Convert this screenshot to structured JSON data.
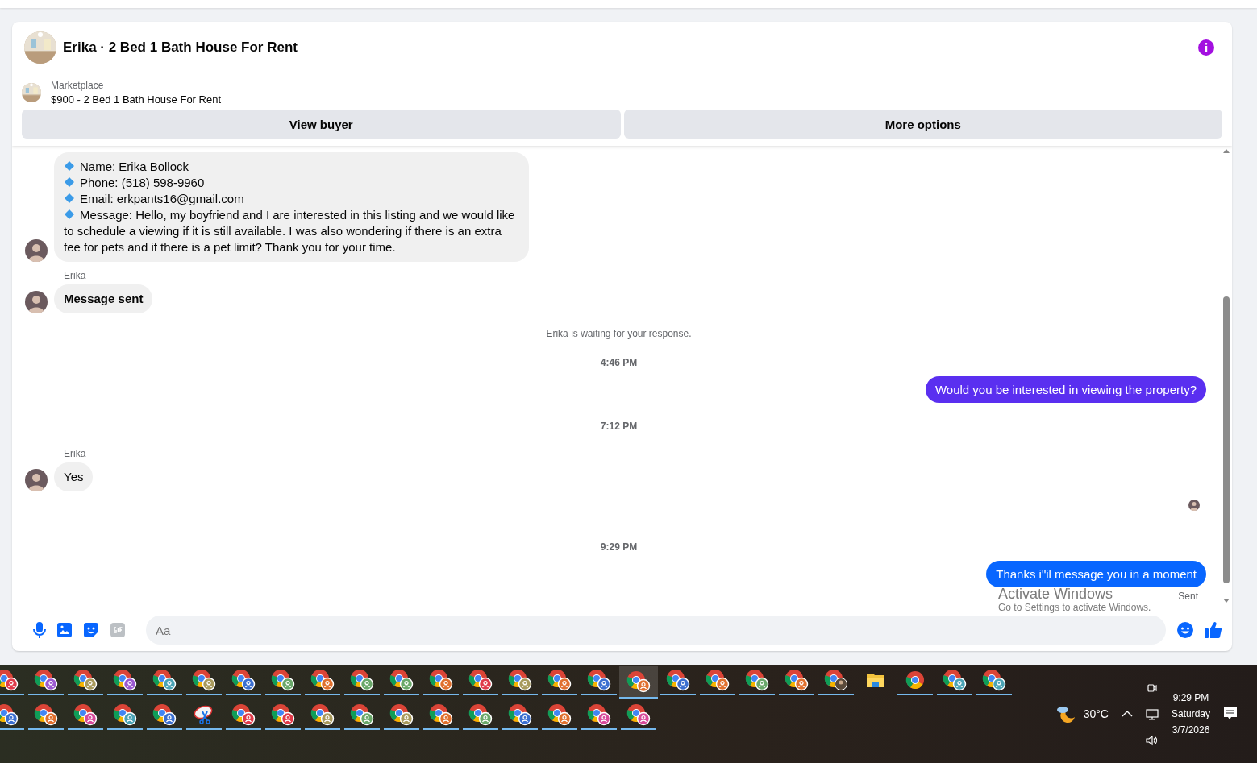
{
  "chat": {
    "title": "Erika · 2 Bed 1 Bath House For Rent",
    "listing": {
      "label": "Marketplace",
      "name": "$900 - 2 Bed 1 Bath House For Rent"
    },
    "actions": [
      "View buyer",
      "More options"
    ],
    "messages": [
      {
        "kind": "details",
        "lines": [
          "Name: Erika Bollock",
          "Phone: (518) 598-9960",
          "Email: erkpants16@gmail.com",
          "Message: Hello, my boyfriend and I are interested in this listing and we would like to schedule a viewing if it is still available. I was also wondering if there is an extra fee for pets and if there is a pet limit? Thank you for your time."
        ]
      },
      {
        "kind": "incoming",
        "sender": "Erika",
        "text": "Message sent",
        "bold": true
      },
      {
        "kind": "notice",
        "text": "Erika is waiting for your response."
      },
      {
        "kind": "time",
        "text": "4:46 PM"
      },
      {
        "kind": "outgoing",
        "text": "Would you be interested in viewing the property?",
        "color": "#5a2ff0"
      },
      {
        "kind": "time",
        "text": "7:12 PM"
      },
      {
        "kind": "incoming",
        "sender": "Erika",
        "text": "Yes",
        "bold": false
      },
      {
        "kind": "seen"
      },
      {
        "kind": "time",
        "text": "9:29 PM"
      },
      {
        "kind": "outgoing",
        "text": "Thanks i\"il message you in a moment",
        "color": "#0866ff"
      },
      {
        "kind": "status",
        "text": "Sent"
      }
    ],
    "composer": {
      "placeholder": "Aa"
    }
  },
  "activation_notice": {
    "title": "Activate Windows",
    "subtitle": "Go to Settings to activate Windows."
  },
  "taskbar": {
    "rows": [
      [
        {
          "kind": "browser",
          "color": "#e03b4a",
          "running": true,
          "selected": false
        },
        {
          "kind": "browser",
          "color": "#9b59d0",
          "running": true,
          "selected": false
        },
        {
          "kind": "browser",
          "color": "#a89a5c",
          "running": true,
          "selected": false
        },
        {
          "kind": "browser",
          "color": "#9b59d0",
          "running": true,
          "selected": false
        },
        {
          "kind": "browser",
          "color": "#4aa3b5",
          "running": true,
          "selected": false
        },
        {
          "kind": "browser",
          "color": "#a89a5c",
          "running": true,
          "selected": false
        },
        {
          "kind": "browser",
          "color": "#3b6fd0",
          "running": true,
          "selected": false
        },
        {
          "kind": "browser",
          "color": "#6aa86a",
          "running": true,
          "selected": false
        },
        {
          "kind": "browser",
          "color": "#e0702e",
          "running": true,
          "selected": false
        },
        {
          "kind": "browser",
          "color": "#6aa86a",
          "running": true,
          "selected": false
        },
        {
          "kind": "browser",
          "color": "#6aa86a",
          "running": true,
          "selected": false
        },
        {
          "kind": "browser",
          "color": "#e0702e",
          "running": true,
          "selected": false
        },
        {
          "kind": "browser",
          "color": "#e03b4a",
          "running": true,
          "selected": false
        },
        {
          "kind": "browser",
          "color": "#a89a5c",
          "running": true,
          "selected": false
        },
        {
          "kind": "browser",
          "color": "#e0702e",
          "running": true,
          "selected": false
        },
        {
          "kind": "browser",
          "color": "#3b6fd0",
          "running": true,
          "selected": false
        },
        {
          "kind": "browser",
          "color": "#e0702e",
          "running": true,
          "selected": true
        },
        {
          "kind": "browser",
          "color": "#3b6fd0",
          "running": true,
          "selected": false
        },
        {
          "kind": "browser",
          "color": "#e0702e",
          "running": true,
          "selected": false
        },
        {
          "kind": "browser",
          "color": "#6aa86a",
          "running": true,
          "selected": false
        },
        {
          "kind": "browser",
          "color": "#e0702e",
          "running": true,
          "selected": false
        },
        {
          "kind": "browser-photo",
          "running": true,
          "selected": false
        },
        {
          "kind": "folder",
          "running": false,
          "selected": false
        },
        {
          "kind": "browser-plain",
          "running": true,
          "selected": false
        },
        {
          "kind": "browser",
          "color": "#4aa3b5",
          "running": true,
          "selected": false
        },
        {
          "kind": "browser",
          "color": "#4aa3b5",
          "running": true,
          "selected": false
        }
      ],
      [
        {
          "kind": "browser",
          "color": "#3b6fd0",
          "running": true,
          "selected": false
        },
        {
          "kind": "browser",
          "color": "#e0702e",
          "running": true,
          "selected": false
        },
        {
          "kind": "browser",
          "color": "#d84a9a",
          "running": true,
          "selected": false
        },
        {
          "kind": "browser",
          "color": "#4aa3b5",
          "running": true,
          "selected": false
        },
        {
          "kind": "browser",
          "color": "#3b6fd0",
          "running": true,
          "selected": false
        },
        {
          "kind": "snip",
          "running": true,
          "selected": false
        },
        {
          "kind": "browser",
          "color": "#e03b4a",
          "running": true,
          "selected": false
        },
        {
          "kind": "browser",
          "color": "#e03b4a",
          "running": true,
          "selected": false
        },
        {
          "kind": "browser",
          "color": "#a89a5c",
          "running": true,
          "selected": false
        },
        {
          "kind": "browser",
          "color": "#6aa86a",
          "running": true,
          "selected": false
        },
        {
          "kind": "browser",
          "color": "#a89a5c",
          "running": true,
          "selected": false
        },
        {
          "kind": "browser",
          "color": "#e0702e",
          "running": true,
          "selected": false
        },
        {
          "kind": "browser",
          "color": "#6aa86a",
          "running": true,
          "selected": false
        },
        {
          "kind": "browser",
          "color": "#3b6fd0",
          "running": true,
          "selected": false
        },
        {
          "kind": "browser",
          "color": "#e0702e",
          "running": true,
          "selected": false
        },
        {
          "kind": "browser",
          "color": "#d84a9a",
          "running": true,
          "selected": false
        },
        {
          "kind": "browser",
          "color": "#d84a9a",
          "running": true,
          "selected": false
        }
      ]
    ],
    "tray": {
      "temperature": "30°C",
      "time": "9:29 PM",
      "day": "Saturday",
      "date": "3/7/2026"
    }
  }
}
